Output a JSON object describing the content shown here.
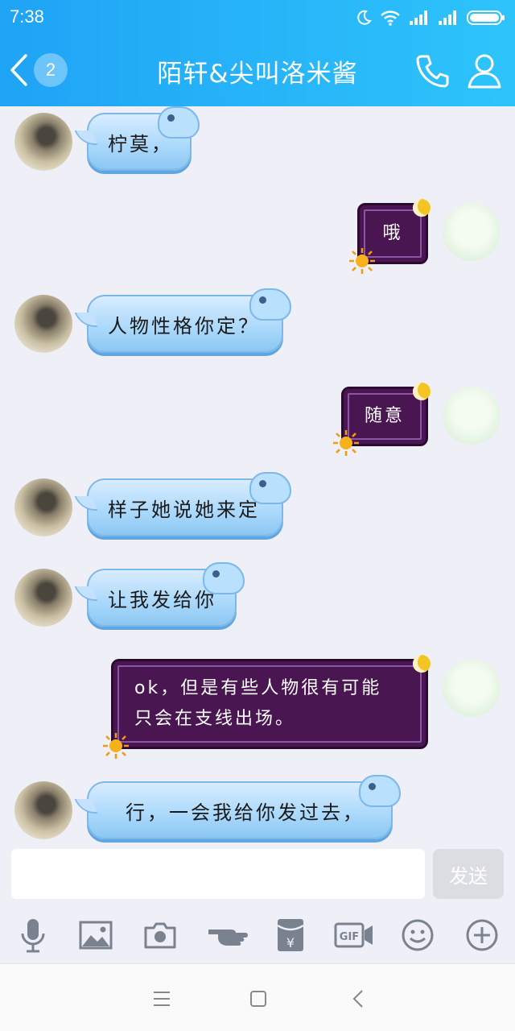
{
  "status_bar": {
    "time": "7:38"
  },
  "header": {
    "back_badge": "2",
    "title": "陌轩&尖叫洛米酱"
  },
  "messages": [
    {
      "side": "left",
      "text": "柠莫，"
    },
    {
      "side": "right",
      "text": "哦"
    },
    {
      "side": "left",
      "text": "人物性格你定？"
    },
    {
      "side": "right",
      "text": "随意"
    },
    {
      "side": "left",
      "text": "样子她说她来定"
    },
    {
      "side": "left",
      "text": "让我发给你"
    },
    {
      "side": "right",
      "line1": "ok，但是有些人物很有可能",
      "line2": "只会在支线出场。"
    },
    {
      "side": "left",
      "text": "行，一会我给你发过去，"
    }
  ],
  "composer": {
    "send_label": "发送",
    "input_value": ""
  },
  "toolbar": {
    "icons": [
      "mic-icon",
      "image-icon",
      "camera-icon",
      "poke-icon",
      "red-packet-icon",
      "gif-icon",
      "emoji-icon",
      "plus-icon"
    ],
    "gif_label": "GIF",
    "yuan_label": "¥"
  },
  "colors": {
    "header_start": "#1fa3f5",
    "header_end": "#2ec4fb",
    "purple_bubble": "#4a1651",
    "blue_bubble": "#a9d8fb"
  }
}
